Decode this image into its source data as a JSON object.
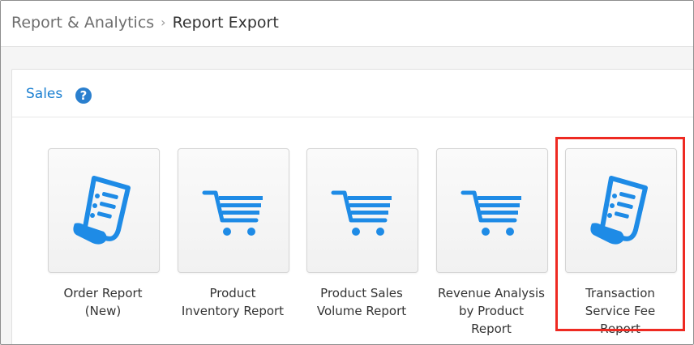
{
  "breadcrumb": {
    "parent": "Report & Analytics",
    "separator": "›",
    "current": "Report Export"
  },
  "section": {
    "title": "Sales",
    "help_icon": "question-circle-icon"
  },
  "colors": {
    "accent": "#1a7fd1",
    "icon_blue": "#1e8be6",
    "highlight": "#ee2a22"
  },
  "reports": [
    {
      "label": "Order Report\n(New)",
      "icon": "receipt-icon"
    },
    {
      "label": "Product\nInventory Report",
      "icon": "shopping-cart-icon"
    },
    {
      "label": "Product Sales\nVolume Report",
      "icon": "shopping-cart-icon"
    },
    {
      "label": "Revenue Analysis\nby Product\nReport",
      "icon": "shopping-cart-icon"
    },
    {
      "label": "Transaction\nService Fee\nReport",
      "icon": "receipt-icon"
    }
  ]
}
